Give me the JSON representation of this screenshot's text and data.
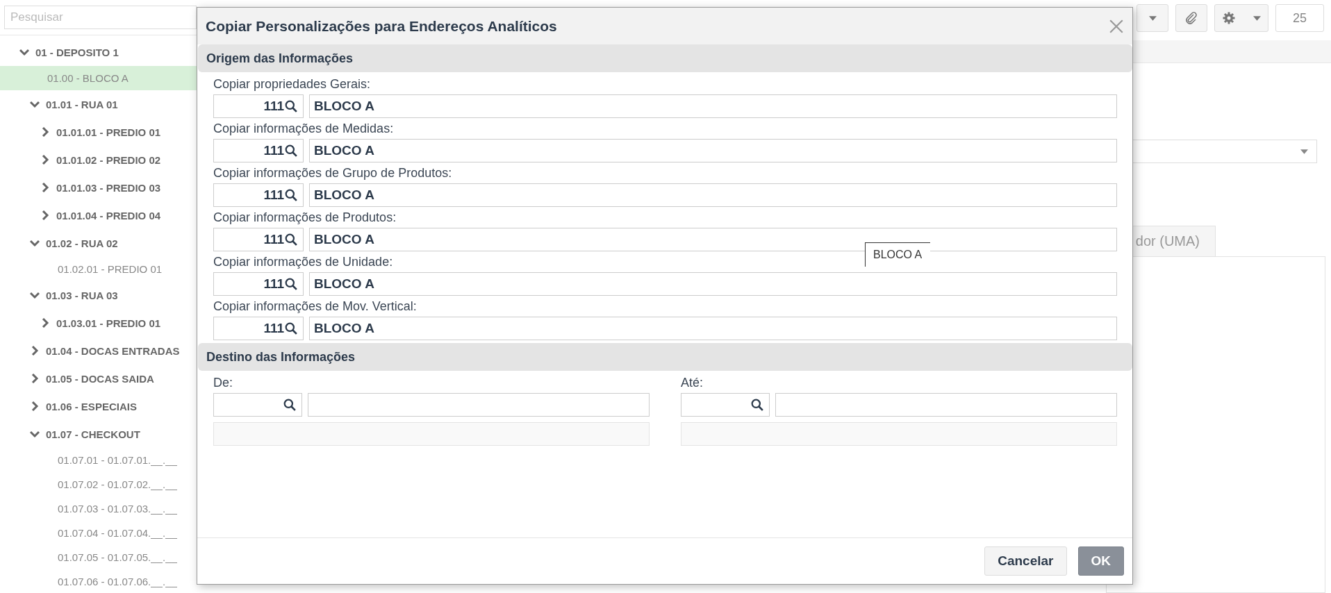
{
  "sidebar": {
    "search": {
      "placeholder": "Pesquisar"
    },
    "tree": [
      {
        "label": "01 - DEPOSITO 1",
        "expanded": true,
        "selected": false,
        "children": [
          {
            "label": "01.00 - BLOCO A",
            "selected": true
          },
          {
            "label": "01.01 - RUA 01",
            "expanded": true,
            "selected": false,
            "children": [
              {
                "label": "01.01.01 - PREDIO 01",
                "expanded": false,
                "selected": false
              },
              {
                "label": "01.01.02 - PREDIO 02",
                "expanded": false,
                "selected": false
              },
              {
                "label": "01.01.03 - PREDIO 03",
                "expanded": false,
                "selected": false
              },
              {
                "label": "01.01.04 - PREDIO 04",
                "expanded": false,
                "selected": false
              }
            ]
          },
          {
            "label": "01.02 - RUA 02",
            "expanded": true,
            "selected": false,
            "children": [
              {
                "label": "01.02.01 - PREDIO 01",
                "selected": false
              }
            ]
          },
          {
            "label": "01.03 - RUA 03",
            "expanded": true,
            "selected": false,
            "children": [
              {
                "label": "01.03.01 - PREDIO 01",
                "expanded": false,
                "selected": false
              }
            ]
          },
          {
            "label": "01.04 - DOCAS ENTRADAS",
            "expanded": false,
            "selected": false
          },
          {
            "label": "01.05 - DOCAS SAIDA",
            "expanded": false,
            "selected": false
          },
          {
            "label": "01.06 - ESPECIAIS",
            "expanded": false,
            "selected": false
          },
          {
            "label": "01.07 - CHECKOUT",
            "expanded": true,
            "selected": false,
            "children": [
              {
                "label": "01.07.01 - 01.07.01.__.__",
                "selected": false
              },
              {
                "label": "01.07.02 - 01.07.02.__.__",
                "selected": false
              },
              {
                "label": "01.07.03 - 01.07.03.__.__",
                "selected": false
              },
              {
                "label": "01.07.04 - 01.07.04.__.__",
                "selected": false
              },
              {
                "label": "01.07.05 - 01.07.05.__.__",
                "selected": false
              },
              {
                "label": "01.07.06 - 01.07.06.__.__",
                "selected": false
              }
            ]
          }
        ]
      }
    ]
  },
  "toolbar": {
    "page_size": "25"
  },
  "main": {
    "tab": {
      "label": "dor (UMA)"
    }
  },
  "dialog": {
    "title": "Copiar Personalizações para Endereços Analíticos",
    "origin": {
      "title": "Origem das Informações",
      "rows": [
        {
          "label": "Copiar propriedades Gerais:",
          "code": "111",
          "name": "BLOCO A"
        },
        {
          "label": "Copiar informações de Medidas:",
          "code": "111",
          "name": "BLOCO A"
        },
        {
          "label": "Copiar informações de Grupo de Produtos:",
          "code": "111",
          "name": "BLOCO A"
        },
        {
          "label": "Copiar informações de Produtos:",
          "code": "111",
          "name": "BLOCO A"
        },
        {
          "label": "Copiar informações de Unidade:",
          "code": "111",
          "name": "BLOCO A"
        },
        {
          "label": "Copiar informações de Mov. Vertical:",
          "code": "111",
          "name": "BLOCO A"
        }
      ]
    },
    "destination": {
      "title": "Destino das Informações",
      "fields": [
        {
          "label": "De:"
        },
        {
          "label": "Até:"
        }
      ]
    },
    "buttons": [
      {
        "label": "Cancelar",
        "kind": "secondary"
      },
      {
        "label": "OK",
        "kind": "primary"
      }
    ]
  },
  "tooltip": {
    "text": "BLOCO A"
  }
}
